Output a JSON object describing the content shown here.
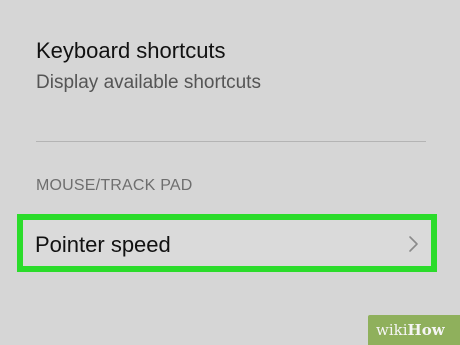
{
  "settings": {
    "keyboard_shortcuts": {
      "title": "Keyboard shortcuts",
      "subtitle": "Display available shortcuts"
    },
    "mouse_section": {
      "header": "MOUSE/TRACK PAD"
    },
    "pointer_speed": {
      "label": "Pointer speed",
      "icon": "chevron-right-icon",
      "highlight_color": "#2bdc2b"
    }
  },
  "watermark": {
    "prefix": "wiki",
    "suffix": "How",
    "color": "#8fb05c"
  }
}
